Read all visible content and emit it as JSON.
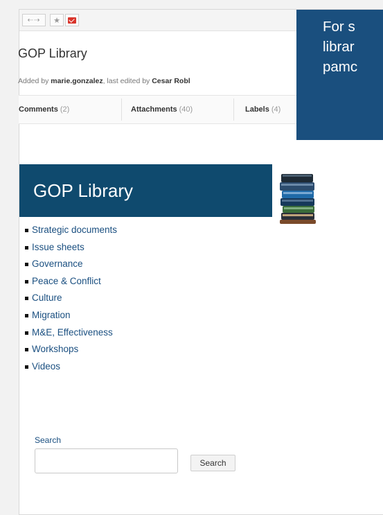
{
  "toolbar": {
    "nav_icon": "back-forward-arrows-icon",
    "star_icon": "star-icon",
    "mail_icon": "mail-icon"
  },
  "page": {
    "title": "GOP Library",
    "byline": {
      "prefix": "Added by",
      "author": "marie.gonzalez",
      "middle": ", last edited by",
      "editor": "Cesar Robl"
    }
  },
  "tabs": [
    {
      "label": "Comments",
      "count": "(2)"
    },
    {
      "label": "Attachments",
      "count": "(40)"
    },
    {
      "label": "Labels",
      "count": "(4)"
    }
  ],
  "banner": {
    "title": "GOP Library",
    "image": "books-stack-icon"
  },
  "links": [
    "Strategic documents",
    "Issue sheets",
    "Governance",
    "Peace & Conflict",
    "Culture",
    "Migration",
    "M&E, Effectiveness",
    "Workshops",
    "Videos"
  ],
  "search": {
    "label": "Search",
    "value": "",
    "button": "Search"
  },
  "callout": {
    "lines": [
      "For s",
      "librar",
      "pamc"
    ]
  },
  "colors": {
    "banner_bg": "#0f4a6e",
    "callout_bg": "#1a4f7e",
    "link": "#1a4f80",
    "mail_icon_red": "#d9342b"
  }
}
